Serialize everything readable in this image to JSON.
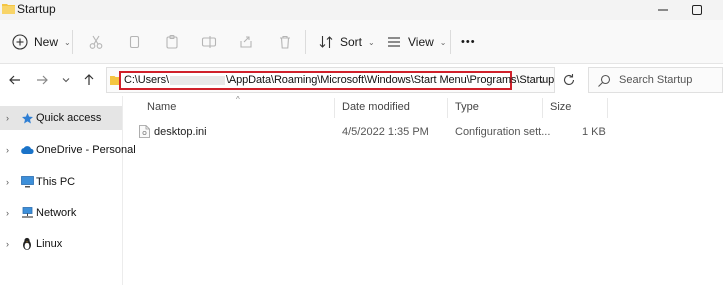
{
  "window": {
    "title": "Startup"
  },
  "toolbar": {
    "new_label": "New",
    "sort_label": "Sort",
    "view_label": "View",
    "more_label": "•••"
  },
  "address": {
    "path_prefix": "C:\\Users\\",
    "path_suffix": "\\AppData\\Roaming\\Microsoft\\Windows\\Start Menu\\Programs\\Startup"
  },
  "search": {
    "placeholder": "Search Startup"
  },
  "sidebar": {
    "items": [
      {
        "label": "Quick access",
        "icon": "star-icon",
        "selected": true
      },
      {
        "label": "OneDrive - Personal",
        "icon": "cloud-icon",
        "selected": false
      },
      {
        "label": "This PC",
        "icon": "monitor-icon",
        "selected": false
      },
      {
        "label": "Network",
        "icon": "network-icon",
        "selected": false
      },
      {
        "label": "Linux",
        "icon": "penguin-icon",
        "selected": false
      }
    ]
  },
  "filelist": {
    "columns": [
      "Name",
      "Date modified",
      "Type",
      "Size"
    ],
    "rows": [
      {
        "name": "desktop.ini",
        "modified": "4/5/2022 1:35 PM",
        "type": "Configuration sett...",
        "size": "1 KB"
      }
    ]
  },
  "colors": {
    "highlight_border": "#d0202a",
    "folder_yellow": "#f4c542",
    "accent_blue": "#1a73c8"
  }
}
